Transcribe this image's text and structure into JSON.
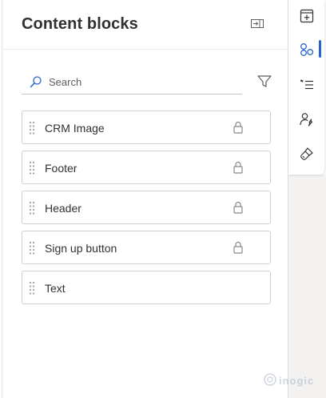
{
  "panel": {
    "title": "Content blocks"
  },
  "search": {
    "placeholder": "Search",
    "value": ""
  },
  "blocks": [
    {
      "label": "CRM Image",
      "locked": true
    },
    {
      "label": "Footer",
      "locked": true
    },
    {
      "label": "Header",
      "locked": true
    },
    {
      "label": "Sign up button",
      "locked": true
    },
    {
      "label": "Text",
      "locked": false
    }
  ],
  "rail": {
    "items": [
      {
        "icon": "add-section-icon",
        "active": false
      },
      {
        "icon": "content-blocks-icon",
        "active": true
      },
      {
        "icon": "personalization-icon",
        "active": false
      },
      {
        "icon": "user-settings-icon",
        "active": false
      },
      {
        "icon": "styles-brush-icon",
        "active": false
      }
    ]
  },
  "colors": {
    "accent": "#2564cf",
    "text": "#323130",
    "border": "#d2d0ce",
    "icon": "#605e5c"
  },
  "watermark": {
    "text": "inogic"
  }
}
